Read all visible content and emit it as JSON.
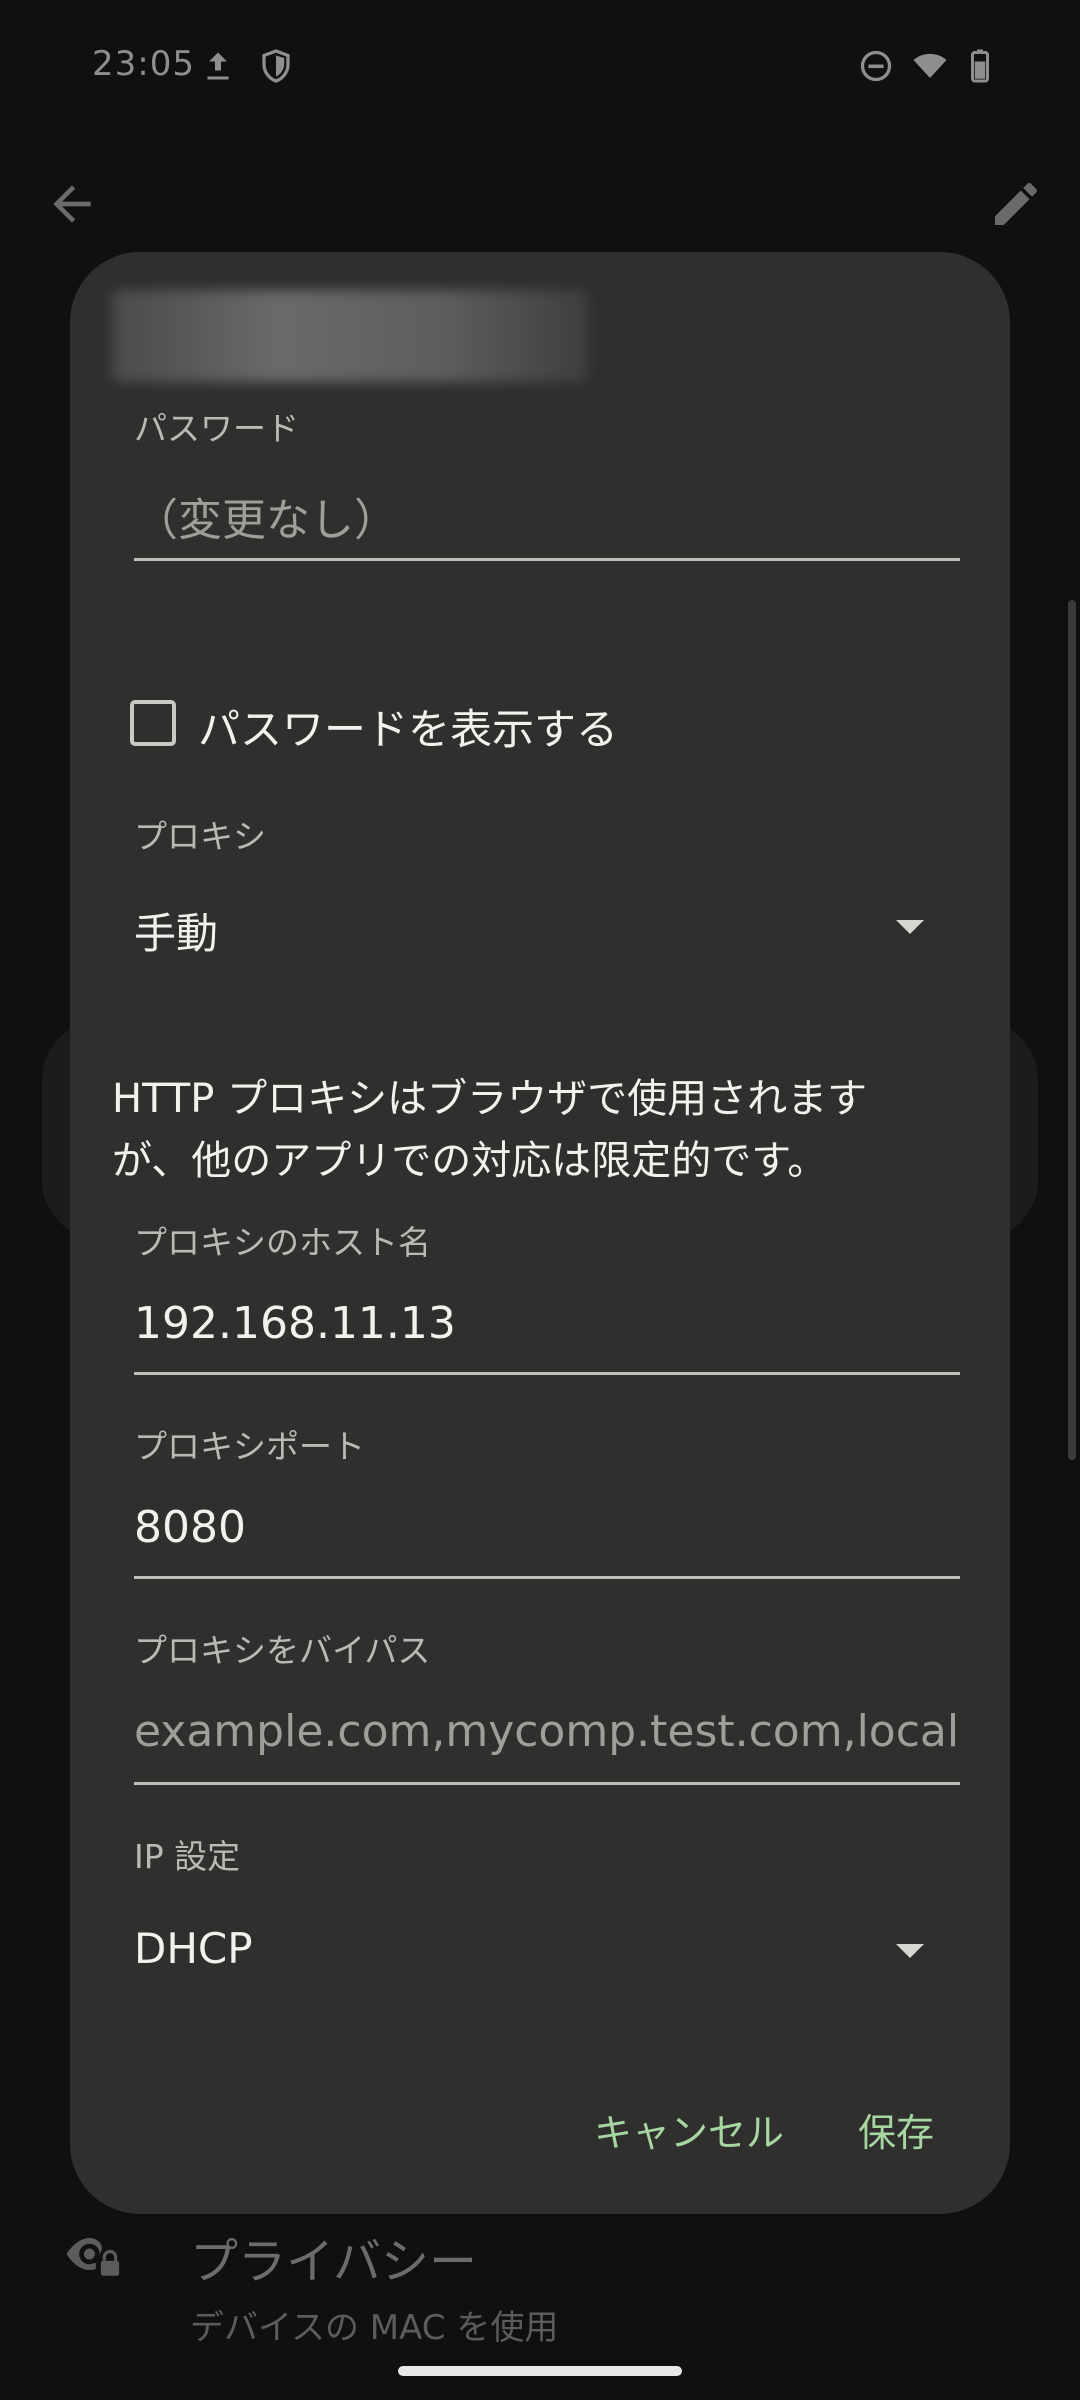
{
  "status_bar": {
    "time": "23:05",
    "icons_left": [
      "upload-icon",
      "shield-icon"
    ],
    "icons_right": [
      "do-not-disturb-icon",
      "wifi-icon",
      "battery-icon"
    ]
  },
  "background": {
    "privacy_title": "プライバシー",
    "privacy_subtitle": "デバイスの MAC を使用"
  },
  "dialog": {
    "password": {
      "label": "パスワード",
      "placeholder": "（変更なし）"
    },
    "show_password": {
      "label": "パスワードを表示する",
      "checked": false
    },
    "proxy": {
      "label": "プロキシ",
      "value": "手動"
    },
    "info_line1": "HTTP プロキシはブラウザで使用されます",
    "info_line2": "が、他のアプリでの対応は限定的です。",
    "proxy_host": {
      "label": "プロキシのホスト名",
      "value": "192.168.11.13"
    },
    "proxy_port": {
      "label": "プロキシポート",
      "value": "8080"
    },
    "proxy_bypass": {
      "label": "プロキシをバイパス",
      "placeholder": "example.com,mycomp.test.com,localhost"
    },
    "ip_settings": {
      "label": "IP 設定",
      "value": "DHCP"
    },
    "cancel_label": "キャンセル",
    "save_label": "保存"
  },
  "colors": {
    "dialog_bg": "#2f302e",
    "accent": "#a6d7a0",
    "text": "#f1f1ee",
    "label": "#b9b9b6"
  }
}
